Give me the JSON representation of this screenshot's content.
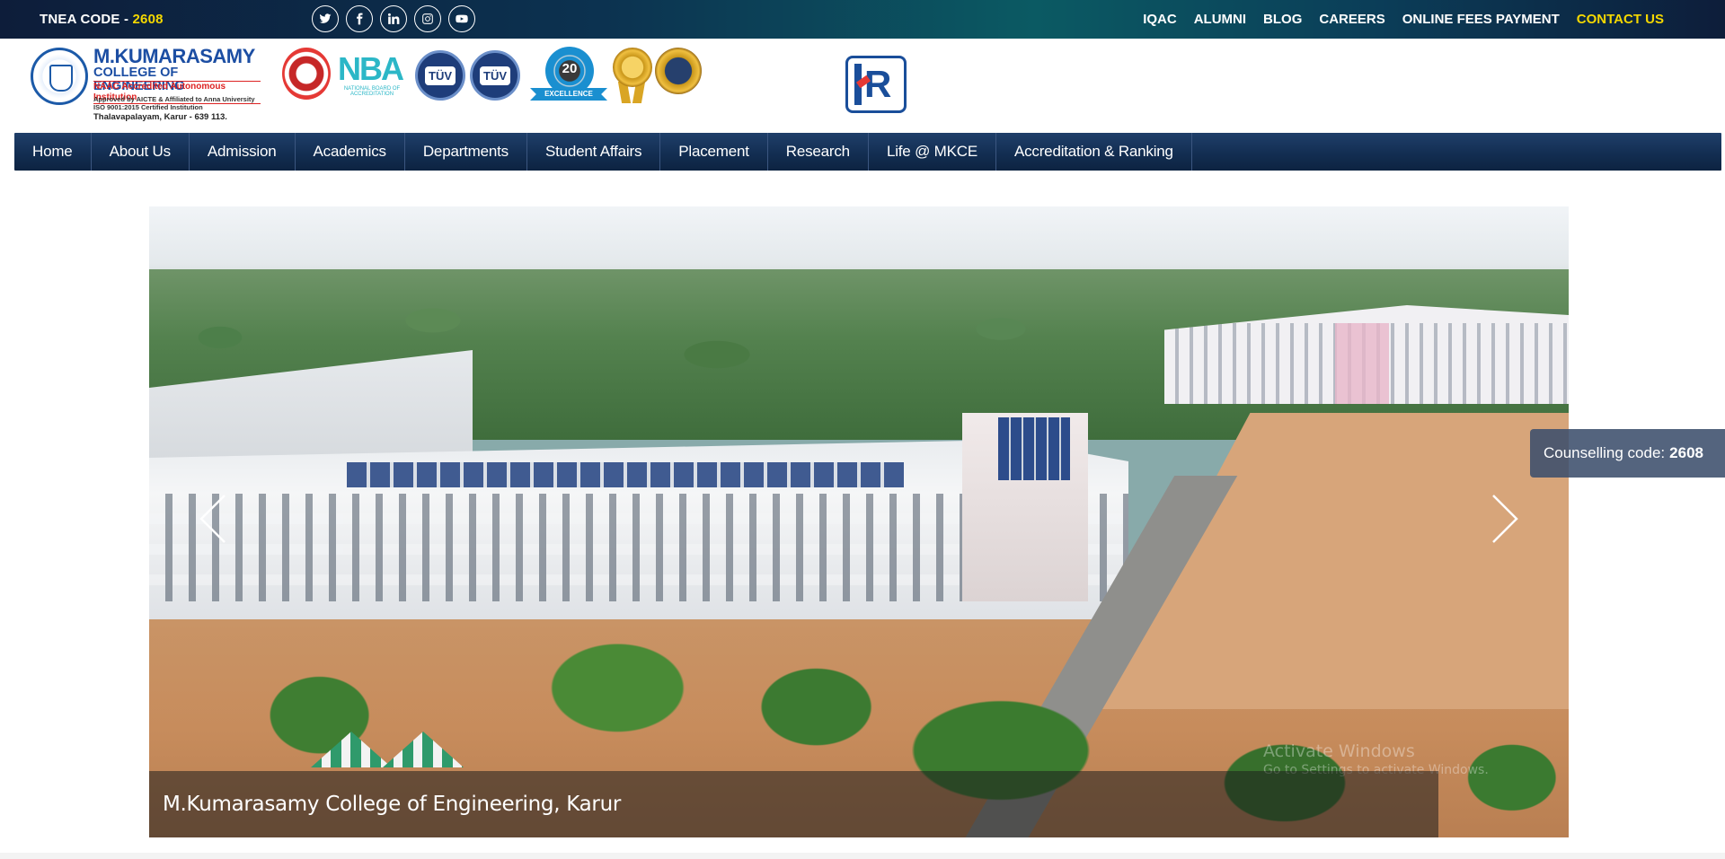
{
  "topbar": {
    "tnea_label": "TNEA CODE - ",
    "tnea_code": "2608",
    "socials": [
      "twitter-icon",
      "facebook-icon",
      "linkedin-icon",
      "instagram-icon",
      "youtube-icon"
    ],
    "links": [
      "IQAC",
      "ALUMNI",
      "BLOG",
      "CAREERS",
      "ONLINE FEES PAYMENT",
      "CONTACT US"
    ],
    "highlight_color": "#f5d800"
  },
  "header": {
    "brand": {
      "name": "M.KUMARASAMY",
      "sub": "COLLEGE OF ENGINEERING",
      "accreditation": "NAAC Accredited Autonomous Institution",
      "line1": "Approved by AICTE & Affiliated to Anna University",
      "line2": "ISO 9001:2015 Certified Institution",
      "line3": "Thalavapalayam, Karur - 639 113."
    },
    "badges": {
      "nba": "NBA",
      "nba_sub": "NATIONAL BOARD OF ACCREDITATION",
      "tuv1": "TÜV",
      "tuv2": "TÜV",
      "excellence_num": "20",
      "excellence_label": "EXCELLENCE"
    },
    "kr_logo": "R"
  },
  "nav": {
    "items": [
      "Home",
      "About Us",
      "Admission",
      "Academics",
      "Departments",
      "Student Affairs",
      "Placement",
      "Research",
      "Life @ MKCE",
      "Accreditation & Ranking"
    ],
    "bar_color": "#132e52"
  },
  "slider": {
    "caption": "M.Kumarasamy College of Engineering, Karur",
    "watermark_line1": "Activate Windows",
    "watermark_line2": "Go to Settings to activate Windows."
  },
  "counselling": {
    "label": "Counselling code:",
    "code": "2608"
  }
}
